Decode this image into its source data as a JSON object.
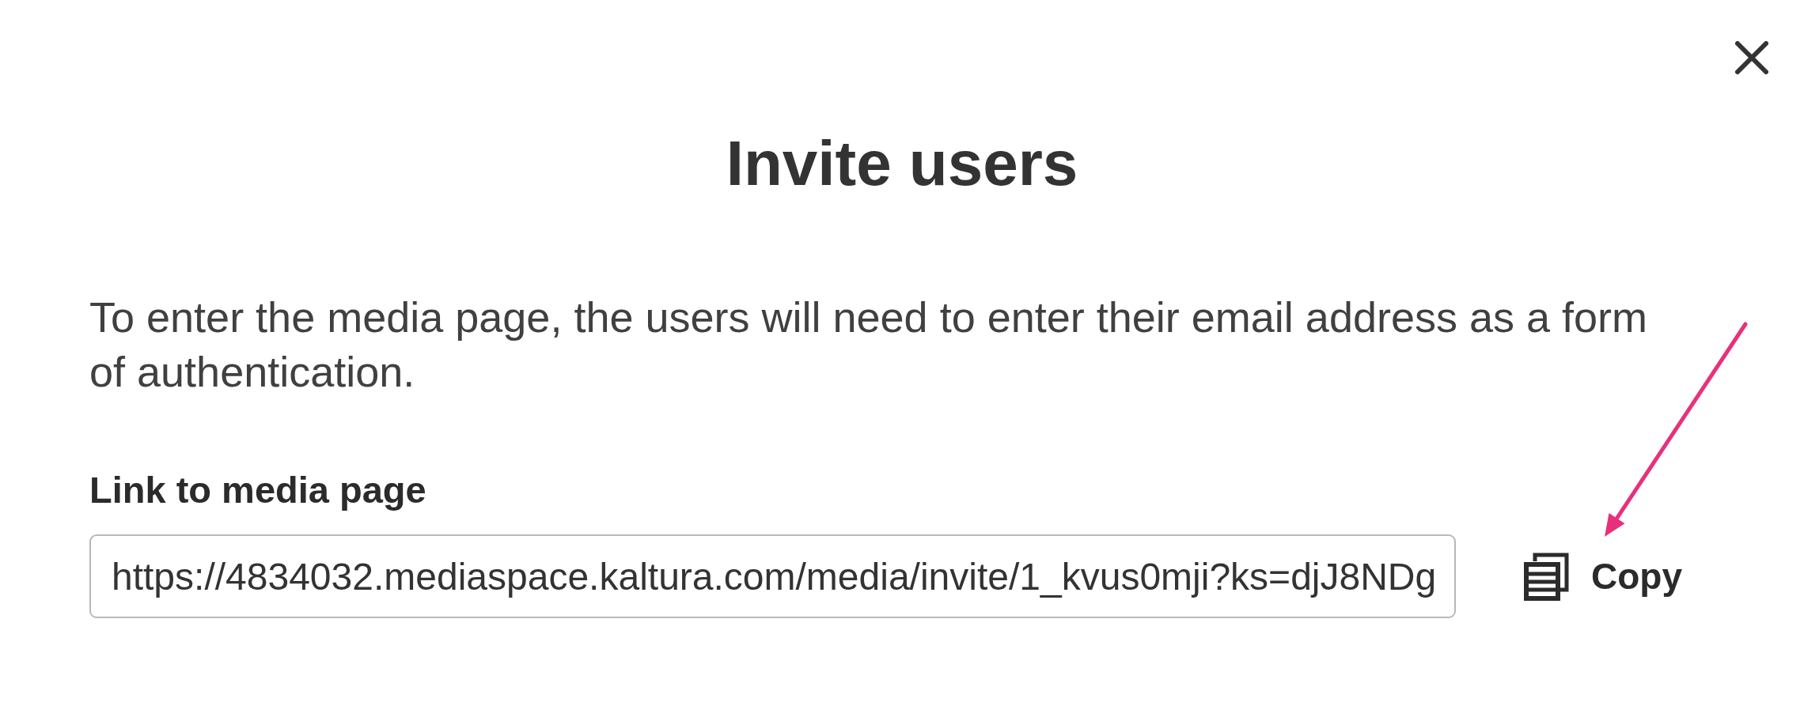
{
  "dialog": {
    "title": "Invite users",
    "description": "To enter the media page, the users will need to enter their email address as a form of authentication.",
    "link_field": {
      "label": "Link to media page",
      "value": "https://4834032.mediaspace.kaltura.com/media/invite/1_kvus0mji?ks=djJ8NDg"
    },
    "copy_button": {
      "label": "Copy"
    }
  }
}
